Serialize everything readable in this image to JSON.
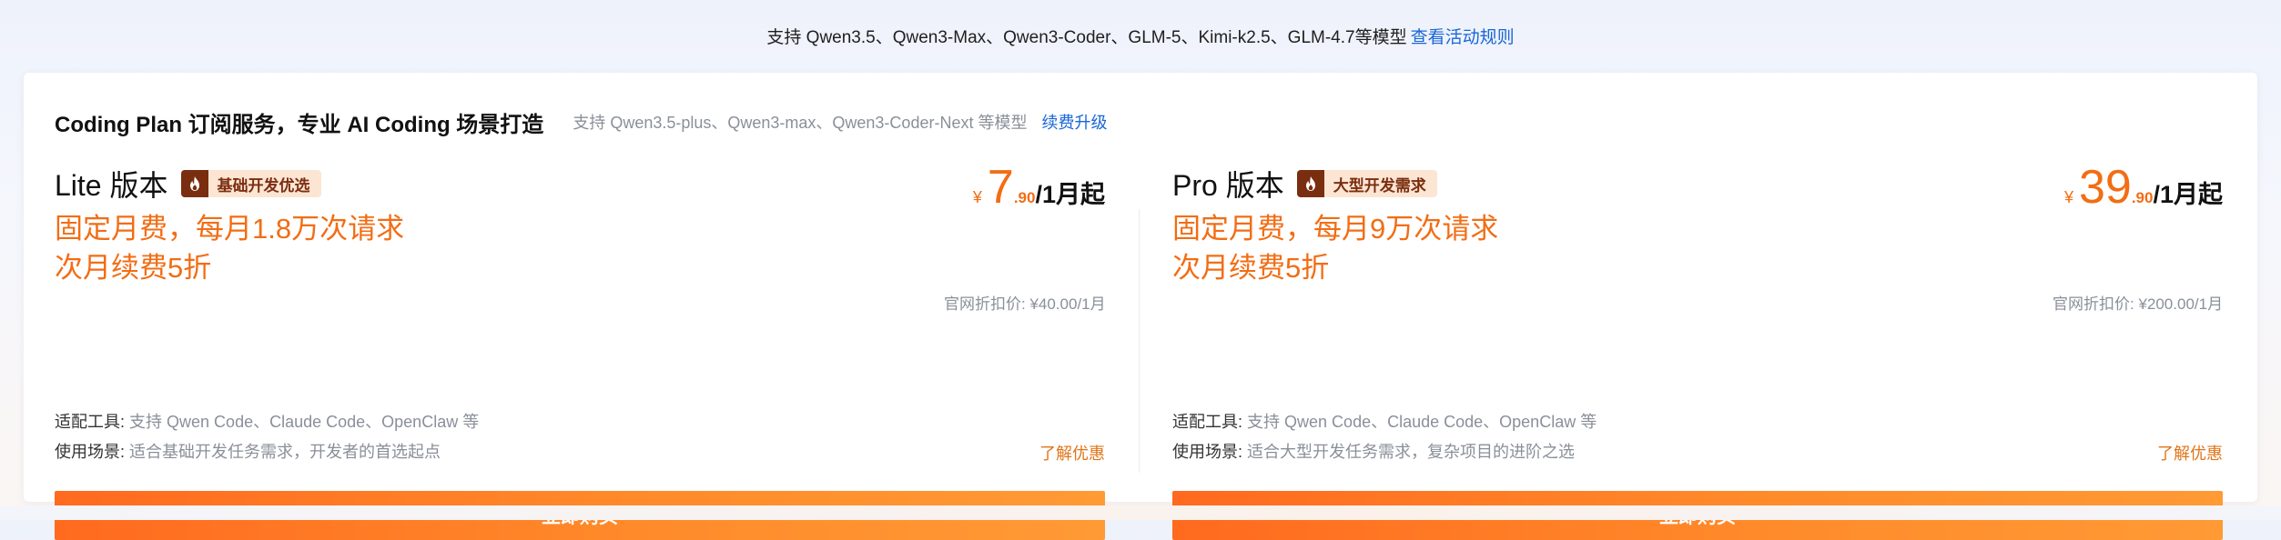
{
  "banner": {
    "text": "支持 Qwen3.5、Qwen3-Max、Qwen3-Coder、GLM-5、Kimi-k2.5、GLM-4.7等模型",
    "link": "查看活动规则"
  },
  "card": {
    "title": "Coding Plan 订阅服务，专业 AI Coding 场景打造",
    "subtitle": "支持 Qwen3.5-plus、Qwen3-max、Qwen3-Coder-Next 等模型",
    "renew_link": "续费升级"
  },
  "plans": [
    {
      "name": "Lite 版本",
      "tag": "基础开发优选",
      "desc_line1": "固定月费，每月1.8万次请求",
      "desc_line2": "次月续费5折",
      "currency": "¥",
      "price_int": "7",
      "price_dec": ".90",
      "price_unit": "/1月起",
      "official": "官网折扣价: ¥40.00/1月",
      "tools_label": "适配工具:",
      "tools_value": "支持 Qwen Code、Claude Code、OpenClaw 等",
      "scene_label": "使用场景:",
      "scene_value": "适合基础开发任务需求，开发者的首选起点",
      "learn_more": "了解优惠",
      "buy": "立即购买"
    },
    {
      "name": "Pro 版本",
      "tag": "大型开发需求",
      "desc_line1": "固定月费，每月9万次请求",
      "desc_line2": "次月续费5折",
      "currency": "¥",
      "price_int": "39",
      "price_dec": ".90",
      "price_unit": "/1月起",
      "official": "官网折扣价: ¥200.00/1月",
      "tools_label": "适配工具:",
      "tools_value": "支持 Qwen Code、Claude Code、OpenClaw 等",
      "scene_label": "使用场景:",
      "scene_value": "适合大型开发任务需求，复杂项目的进阶之选",
      "learn_more": "了解优惠",
      "buy": "立即购买"
    }
  ],
  "icons": {
    "tag_icon": "flame-icon"
  },
  "colors": {
    "accent": "#f26d14",
    "link": "#1a66d8",
    "tag_bg": "#fde5d4",
    "tag_dark": "#7a2e10",
    "button_start": "#ff6a1f",
    "button_end": "#ff9a35"
  }
}
